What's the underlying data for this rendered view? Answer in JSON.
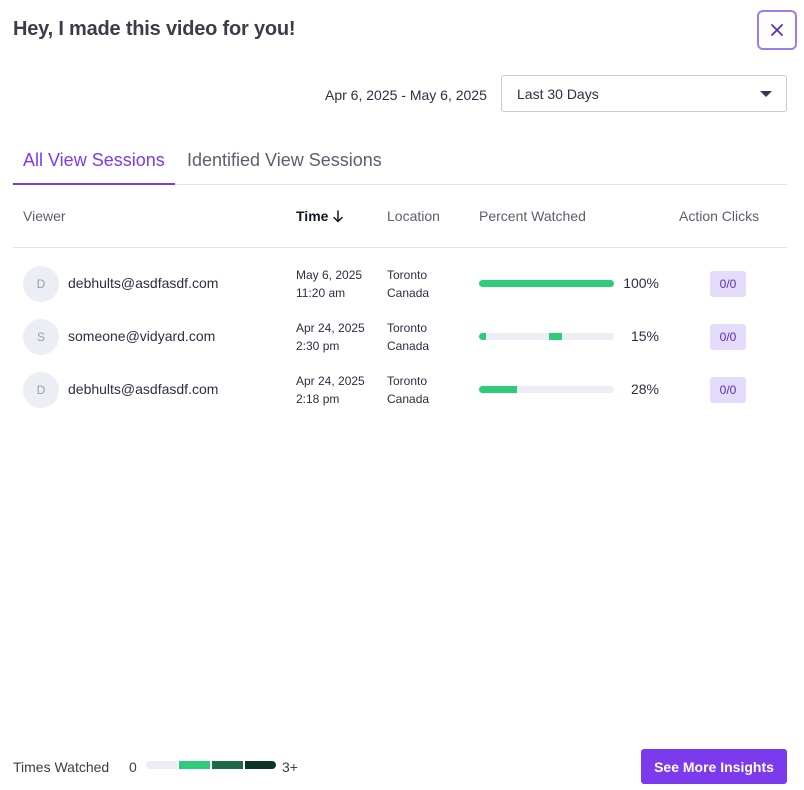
{
  "header": {
    "title": "Hey, I made this video for you!",
    "close_icon": "close-icon"
  },
  "date_range": {
    "text": "Apr 6, 2025 - May 6, 2025",
    "selected": "Last 30 Days"
  },
  "tabs": [
    {
      "label": "All View Sessions",
      "active": true
    },
    {
      "label": "Identified View Sessions",
      "active": false
    }
  ],
  "columns": {
    "viewer": "Viewer",
    "time": "Time",
    "location": "Location",
    "percent": "Percent Watched",
    "clicks": "Action Clicks"
  },
  "rows": [
    {
      "initial": "D",
      "email": "debhults@asdfasdf.com",
      "date": "May 6, 2025",
      "time": "11:20 am",
      "city": "Toronto",
      "country": "Canada",
      "percent": "100%",
      "clicks": "0/0",
      "watched_segments": [
        [
          0,
          1
        ]
      ]
    },
    {
      "initial": "S",
      "email": "someone@vidyard.com",
      "date": "Apr 24, 2025",
      "time": "2:30 pm",
      "city": "Toronto",
      "country": "Canada",
      "percent": "15%",
      "clicks": "0/0",
      "watched_segments": [
        [
          0,
          0.05
        ],
        [
          0.52,
          0.62
        ]
      ]
    },
    {
      "initial": "D",
      "email": "debhults@asdfasdf.com",
      "date": "Apr 24, 2025",
      "time": "2:18 pm",
      "city": "Toronto",
      "country": "Canada",
      "percent": "28%",
      "clicks": "0/0",
      "watched_segments": [
        [
          0,
          0.28
        ]
      ]
    }
  ],
  "legend": {
    "label": "Times Watched",
    "min": "0",
    "max": "3+",
    "colors": [
      "#eceef6",
      "#2ecc7a",
      "#1d6a45",
      "#0f3324"
    ]
  },
  "cta": {
    "label": "See More Insights"
  },
  "colors": {
    "accent": "#7c3aed",
    "progress": "#2ecc7a",
    "badge_bg": "#e5dcfb"
  }
}
